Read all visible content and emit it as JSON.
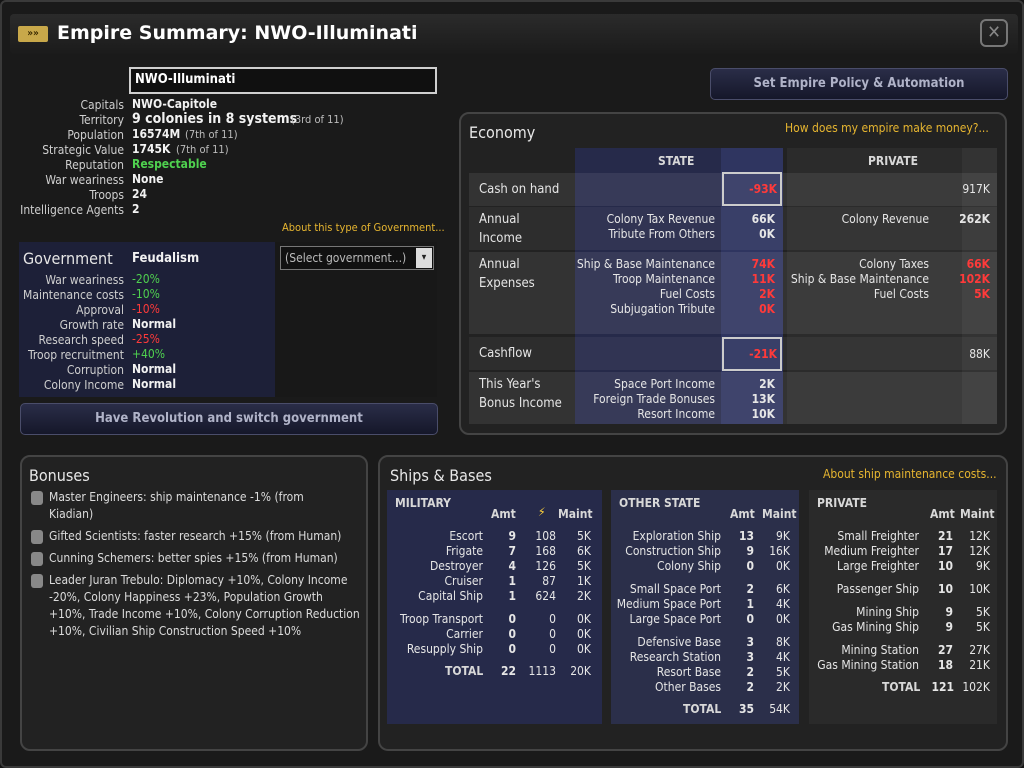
{
  "window": {
    "title": "Empire Summary: NWO-Illuminati",
    "close_symbol": "✕",
    "tag_symbol": "»»"
  },
  "empire_name": "NWO-Illuminati",
  "policy_button": "Set Empire Policy & Automation",
  "stats": {
    "capitals_label": "Capitals",
    "capitals": "NWO-Capitole",
    "territory_label": "Territory",
    "territory": "9 colonies in 8 systems",
    "territory_rank": "(3rd of 11)",
    "population_label": "Population",
    "population": "16574M",
    "population_rank": "(7th of 11)",
    "strategic_label": "Strategic Value",
    "strategic": "1745K",
    "strategic_rank": "(7th of 11)",
    "reputation_label": "Reputation",
    "reputation": "Respectable",
    "war_label": "War weariness",
    "war": "None",
    "troops_label": "Troops",
    "troops": "24",
    "agents_label": "Intelligence Agents",
    "agents": "2"
  },
  "gov_link": "About this type of Government...",
  "government": {
    "title": "Government",
    "type": "Feudalism",
    "select_placeholder": "(Select government...)",
    "rows": [
      {
        "label": "War weariness",
        "value": "-20%",
        "tone": "green"
      },
      {
        "label": "Maintenance costs",
        "value": "-10%",
        "tone": "green"
      },
      {
        "label": "Approval",
        "value": "-10%",
        "tone": "red"
      },
      {
        "label": "Growth rate",
        "value": "Normal",
        "tone": "normal"
      },
      {
        "label": "Research speed",
        "value": "-25%",
        "tone": "red"
      },
      {
        "label": "Troop recruitment",
        "value": "+40%",
        "tone": "green"
      },
      {
        "label": "Corruption",
        "value": "Normal",
        "tone": "normal"
      },
      {
        "label": "Colony Income",
        "value": "Normal",
        "tone": "normal"
      }
    ],
    "revolution_button": "Have Revolution and switch government"
  },
  "economy": {
    "title": "Economy",
    "help_link": "How does my empire make money?...",
    "state_header": "STATE",
    "private_header": "PRIVATE",
    "cash_label": "Cash on hand",
    "cash_state": "-93K",
    "cash_private": "917K",
    "income_label_1": "Annual",
    "income_label_2": "Income",
    "income_state": [
      {
        "label": "Colony Tax Revenue",
        "value": "66K"
      },
      {
        "label": "Tribute From Others",
        "value": "0K"
      }
    ],
    "income_private": [
      {
        "label": "Colony Revenue",
        "value": "262K"
      }
    ],
    "expense_label_1": "Annual",
    "expense_label_2": "Expenses",
    "expense_state": [
      {
        "label": "Ship & Base Maintenance",
        "value": "74K"
      },
      {
        "label": "Troop Maintenance",
        "value": "11K"
      },
      {
        "label": "Fuel Costs",
        "value": "2K"
      },
      {
        "label": "Subjugation Tribute",
        "value": "0K"
      }
    ],
    "expense_private": [
      {
        "label": "Colony Taxes",
        "value": "66K"
      },
      {
        "label": "Ship & Base Maintenance",
        "value": "102K"
      },
      {
        "label": "Fuel Costs",
        "value": "5K"
      }
    ],
    "cashflow_label": "Cashflow",
    "cashflow_state": "-21K",
    "cashflow_private": "88K",
    "bonus_label_1": "This Year's",
    "bonus_label_2": "Bonus Income",
    "bonus_state": [
      {
        "label": "Space Port Income",
        "value": "2K"
      },
      {
        "label": "Foreign Trade Bonuses",
        "value": "13K"
      },
      {
        "label": "Resort Income",
        "value": "10K"
      }
    ]
  },
  "bonuses": {
    "title": "Bonuses",
    "items": [
      {
        "line1": "Master Engineers: ship maintenance -1% (from",
        "line2": "Kiadian)"
      },
      {
        "line1": "Gifted Scientists: faster research +15% (from Human)"
      },
      {
        "line1": "Cunning Schemers: better spies +15% (from Human)"
      },
      {
        "line1": "Leader Juran Trebulo: Diplomacy +10%, Colony Income",
        "line2": "-20%, Colony Happiness +23%, Population Growth",
        "line3": "+10%, Trade Income +10%, Colony Corruption Reduction",
        "line4": "+10%, Civilian Ship Construction Speed +10%"
      }
    ]
  },
  "ships": {
    "title": "Ships & Bases",
    "link": "About ship maintenance costs...",
    "military": {
      "title": "MILITARY",
      "amt": "Amt",
      "power": "⚡",
      "maint": "Maint",
      "rows": [
        {
          "name": "Escort",
          "amt": "9",
          "power": "108",
          "maint": "5K"
        },
        {
          "name": "Frigate",
          "amt": "7",
          "power": "168",
          "maint": "6K"
        },
        {
          "name": "Destroyer",
          "amt": "4",
          "power": "126",
          "maint": "5K"
        },
        {
          "name": "Cruiser",
          "amt": "1",
          "power": "87",
          "maint": "1K"
        },
        {
          "name": "Capital Ship",
          "amt": "1",
          "power": "624",
          "maint": "2K"
        },
        {
          "name": "Troop Transport",
          "amt": "0",
          "power": "0",
          "maint": "0K"
        },
        {
          "name": "Carrier",
          "amt": "0",
          "power": "0",
          "maint": "0K"
        },
        {
          "name": "Resupply Ship",
          "amt": "0",
          "power": "0",
          "maint": "0K"
        }
      ],
      "total_label": "TOTAL",
      "total_amt": "22",
      "total_power": "1113",
      "total_maint": "20K"
    },
    "other": {
      "title": "OTHER STATE",
      "amt": "Amt",
      "maint": "Maint",
      "rows": [
        {
          "name": "Exploration Ship",
          "amt": "13",
          "maint": "9K"
        },
        {
          "name": "Construction Ship",
          "amt": "9",
          "maint": "16K"
        },
        {
          "name": "Colony Ship",
          "amt": "0",
          "maint": "0K"
        },
        {
          "name": "Small Space Port",
          "amt": "2",
          "maint": "6K"
        },
        {
          "name": "Medium Space Port",
          "amt": "1",
          "maint": "4K"
        },
        {
          "name": "Large Space Port",
          "amt": "0",
          "maint": "0K"
        },
        {
          "name": "Defensive Base",
          "amt": "3",
          "maint": "8K"
        },
        {
          "name": "Research Station",
          "amt": "3",
          "maint": "4K"
        },
        {
          "name": "Resort Base",
          "amt": "2",
          "maint": "5K"
        },
        {
          "name": "Other Bases",
          "amt": "2",
          "maint": "2K"
        }
      ],
      "total_label": "TOTAL",
      "total_amt": "35",
      "total_maint": "54K"
    },
    "private": {
      "title": "PRIVATE",
      "amt": "Amt",
      "maint": "Maint",
      "rows": [
        {
          "name": "Small Freighter",
          "amt": "21",
          "maint": "12K"
        },
        {
          "name": "Medium Freighter",
          "amt": "17",
          "maint": "12K"
        },
        {
          "name": "Large Freighter",
          "amt": "10",
          "maint": "9K"
        },
        {
          "name": "Passenger Ship",
          "amt": "10",
          "maint": "10K"
        },
        {
          "name": "Mining Ship",
          "amt": "9",
          "maint": "5K"
        },
        {
          "name": "Gas Mining Ship",
          "amt": "9",
          "maint": "5K"
        },
        {
          "name": "Mining Station",
          "amt": "27",
          "maint": "27K"
        },
        {
          "name": "Gas Mining Station",
          "amt": "18",
          "maint": "21K"
        }
      ],
      "total_label": "TOTAL",
      "total_amt": "121",
      "total_maint": "102K"
    }
  }
}
